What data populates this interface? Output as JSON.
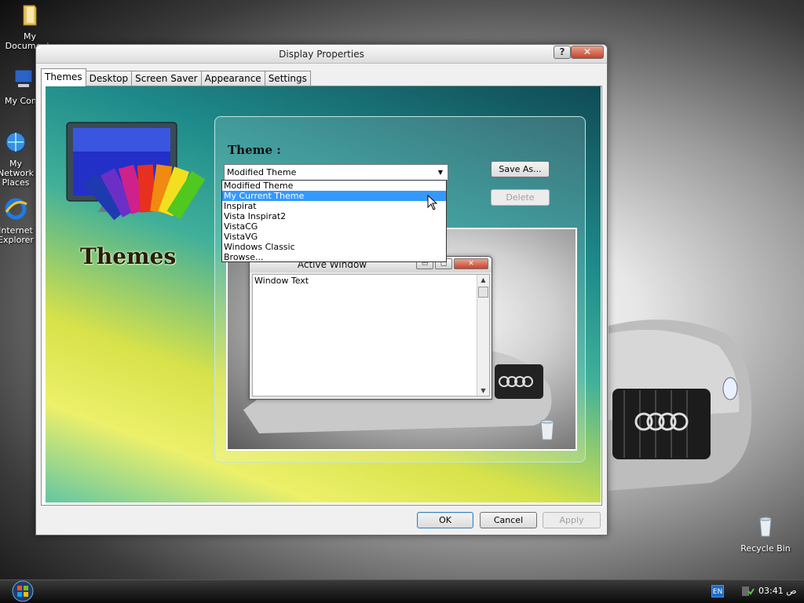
{
  "desktop": {
    "icons": [
      {
        "label": "My Documents",
        "icon": "folder-icon"
      },
      {
        "label": "My Computer",
        "icon": "computer-icon"
      },
      {
        "label": "My Network Places",
        "icon": "network-icon"
      },
      {
        "label": "Internet Explorer",
        "icon": "internet-explorer-icon"
      },
      {
        "label": "Recycle Bin",
        "icon": "recycle-bin-icon"
      }
    ]
  },
  "window": {
    "title": "Display Properties",
    "help_glyph": "?",
    "close_glyph": "✕",
    "tabs": [
      "Themes",
      "Desktop",
      "Screen Saver",
      "Appearance",
      "Settings"
    ],
    "active_tab": "Themes"
  },
  "themes_page": {
    "brand_label": "Themes",
    "heading": "Theme :",
    "combo_value": "Modified Theme",
    "combo_arrow": "▼",
    "save_as_button": "Save As...",
    "delete_button": "Delete",
    "dropdown_options": [
      "Modified Theme",
      "My Current Theme",
      "Inspirat",
      "Vista Inspirat2",
      "VistaCG",
      "VistaVG",
      "Windows Classic",
      "Browse..."
    ],
    "dropdown_selected_index": 1,
    "preview": {
      "window_title": "Active Window",
      "min_glyph": "▭",
      "max_glyph": "▢",
      "close_glyph": "✕",
      "window_text": "Window Text",
      "scroll_up": "▲",
      "scroll_down": "▼"
    }
  },
  "dialog_buttons": {
    "ok": "OK",
    "cancel": "Cancel",
    "apply": "Apply"
  },
  "taskbar": {
    "language": "EN",
    "clock": "03:41 ص"
  }
}
